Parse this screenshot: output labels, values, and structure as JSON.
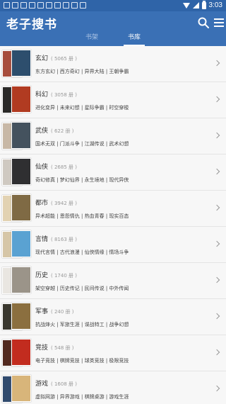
{
  "app": {
    "title": "老子搜书",
    "time": "3:03",
    "tabs": [
      "书架",
      "书库"
    ],
    "accent": "#3a70b5"
  },
  "icons": {
    "search": "search-icon",
    "menu": "menu-icon"
  },
  "categories": [
    {
      "name": "玄幻",
      "count": "( 5065 册 )",
      "subs": "东方玄幻 | 西方奇幻 | 异界大陆 | 王朝争霸",
      "colors": [
        "#a74d3d",
        "#2d4e6d"
      ]
    },
    {
      "name": "科幻",
      "count": "( 3058 册 )",
      "subs": "进化变异 | 未来幻想 | 星际争霸 | 时空穿梭",
      "colors": [
        "#2a2928",
        "#b13b21"
      ]
    },
    {
      "name": "武侠",
      "count": "( 622 册 )",
      "subs": "国术无双 | 门派斗争 | 江湖传说 | 武术幻想",
      "colors": [
        "#c8b8a6",
        "#44525e"
      ]
    },
    {
      "name": "仙侠",
      "count": "( 2685 册 )",
      "subs": "奇幻修真 | 梦幻仙界 | 永生境地 | 现代异侠",
      "colors": [
        "#cfc9c1",
        "#2f2f31"
      ]
    },
    {
      "name": "都市",
      "count": "( 3942 册 )",
      "subs": "异术超能 | 恩怨情仇 | 热血青春 | 现实百态",
      "colors": [
        "#e2d2b2",
        "#7f6a44"
      ]
    },
    {
      "name": "言情",
      "count": "( 8163 册 )",
      "subs": "现代言情 | 古代浪漫 | 仙侠情缘 | 情场斗争",
      "colors": [
        "#d6c6a7",
        "#5aa2d2"
      ]
    },
    {
      "name": "历史",
      "count": "( 1740 册 )",
      "subs": "架空穿越 | 历史传记 | 民间传说 | 中外传闻",
      "colors": [
        "#e9e6e1",
        "#9b9489"
      ]
    },
    {
      "name": "军事",
      "count": "( 240 册 )",
      "subs": "抗战烽火 | 军旅生涯 | 谍战特工 | 战争幻想",
      "colors": [
        "#3a382f",
        "#8b6f3f"
      ]
    },
    {
      "name": "竞技",
      "count": "( 548 册 )",
      "subs": "电子竞技 | 棋牌竞技 | 球类竞技 | 极限竞技",
      "colors": [
        "#522a1f",
        "#c22c1f"
      ]
    },
    {
      "name": "游戏",
      "count": "( 1608 册 )",
      "subs": "虚拟网游 | 异界游戏 | 棋牌桌游 | 游戏生涯",
      "colors": [
        "#314b6e",
        "#d8b57a"
      ]
    }
  ]
}
